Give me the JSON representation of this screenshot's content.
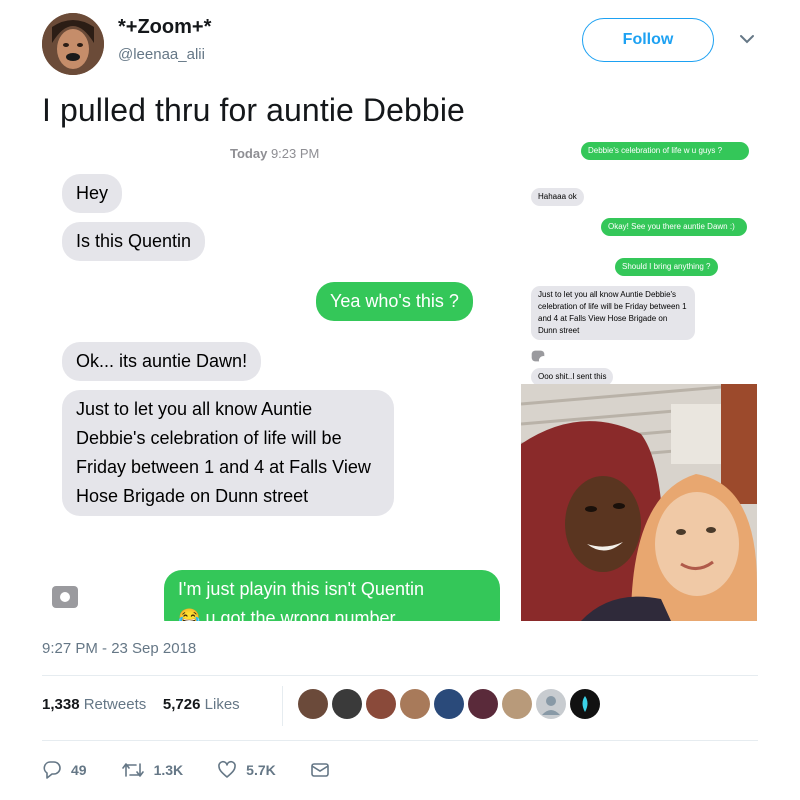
{
  "tweet": {
    "author": {
      "display_name": "*+Zoom+*",
      "handle": "@leenaa_alii",
      "avatar_icon": "user-avatar"
    },
    "follow_label": "Follow",
    "text": "I pulled thru for auntie Debbie",
    "timestamp": "9:27 PM - 23 Sep 2018",
    "retweets": {
      "count": "1,338",
      "label": "Retweets"
    },
    "likes": {
      "count": "5,726",
      "label": "Likes"
    },
    "actions": {
      "reply_count": "49",
      "retweet_count": "1.3K",
      "like_count": "5.7K"
    }
  },
  "screenshot_left": {
    "header_day": "Today",
    "header_time": "9:23 PM",
    "messages": [
      "Hey",
      "Is this Quentin",
      "Yea who's this ?",
      "Ok... its auntie Dawn!",
      "Just to let you all know Auntie Debbie's celebration of life will be Friday between 1 and 4 at Falls View Hose Brigade on Dunn street",
      "I'm just playin this isn't Quentin",
      "u got the wrong number"
    ]
  },
  "screenshot_right": {
    "messages": [
      "Debbie's celebration of life w u guys ?",
      "Hahaaa ok",
      "Okay! See you there auntie Dawn :)",
      "Should I bring anything ?",
      "Just to let you all know Auntie Debbie's celebration of life will be Friday between 1 and 4 at Falls View Hose Brigade on Dunn street",
      "Ooo shit..I sent this"
    ]
  },
  "colors": {
    "twitter_blue": "#1da1f2",
    "imessage_green": "#34c759",
    "imessage_gray": "#e5e5ea",
    "secondary_text": "#657786"
  }
}
